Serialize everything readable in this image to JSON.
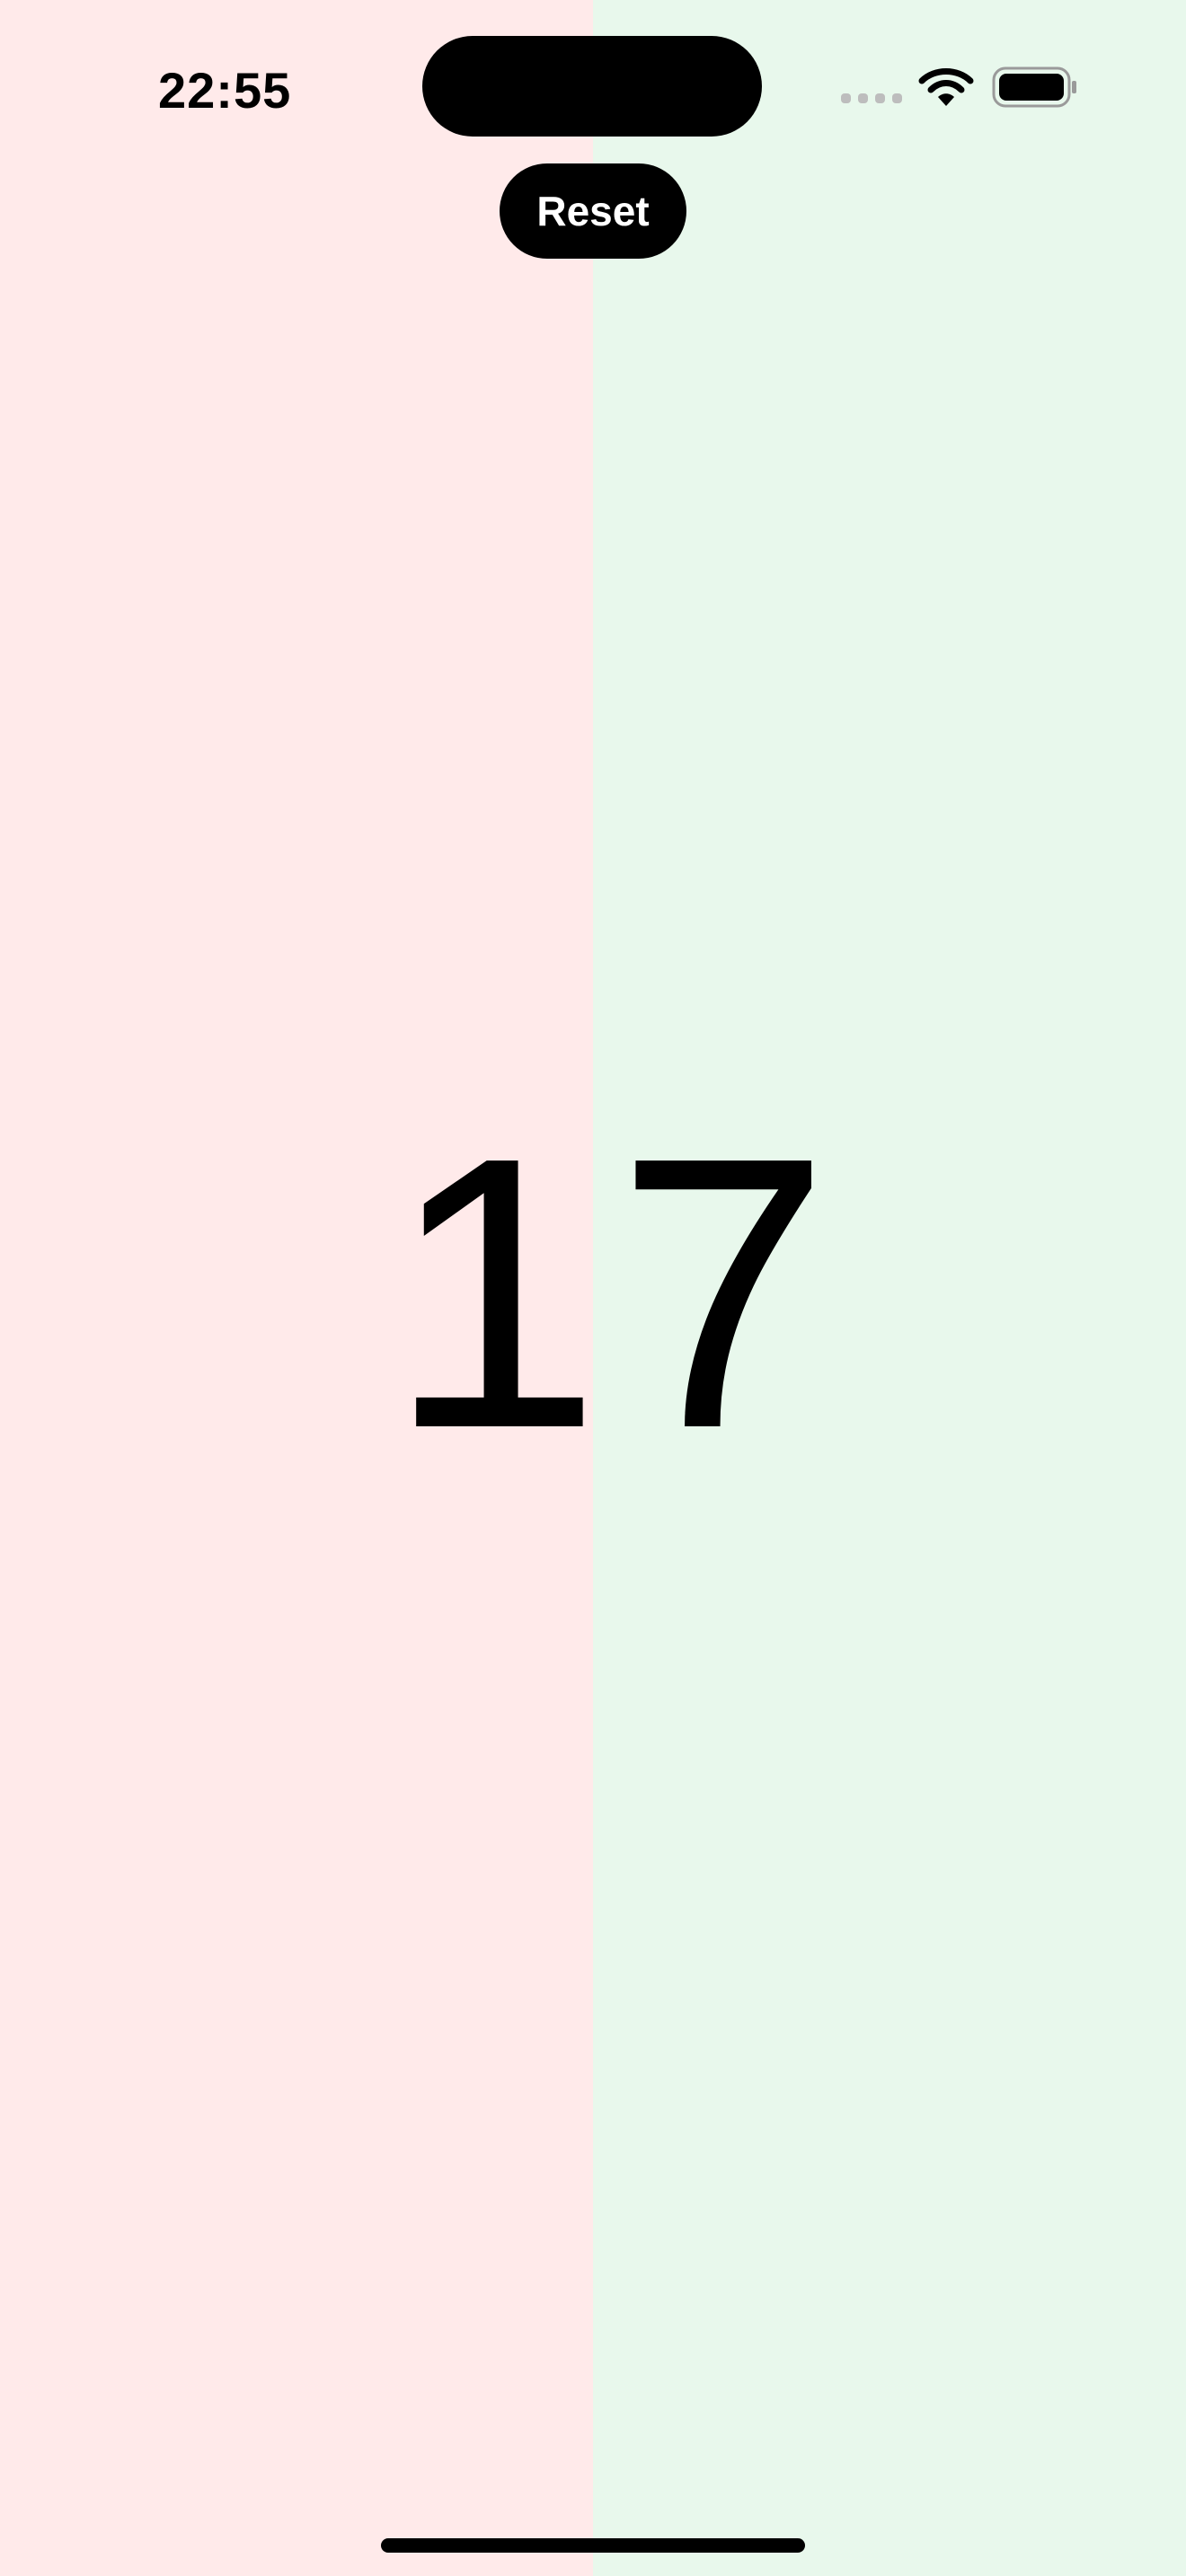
{
  "colors": {
    "left_panel": "#ffeaea",
    "right_panel": "#e8f8ec",
    "text": "#000000",
    "button_bg": "#000000",
    "button_text": "#ffffff"
  },
  "status_bar": {
    "time": "22:55",
    "icons": [
      "cellular-signal-icon",
      "wifi-icon",
      "battery-icon"
    ]
  },
  "controls": {
    "reset_label": "Reset"
  },
  "scores": {
    "left": "1",
    "right": "7"
  }
}
